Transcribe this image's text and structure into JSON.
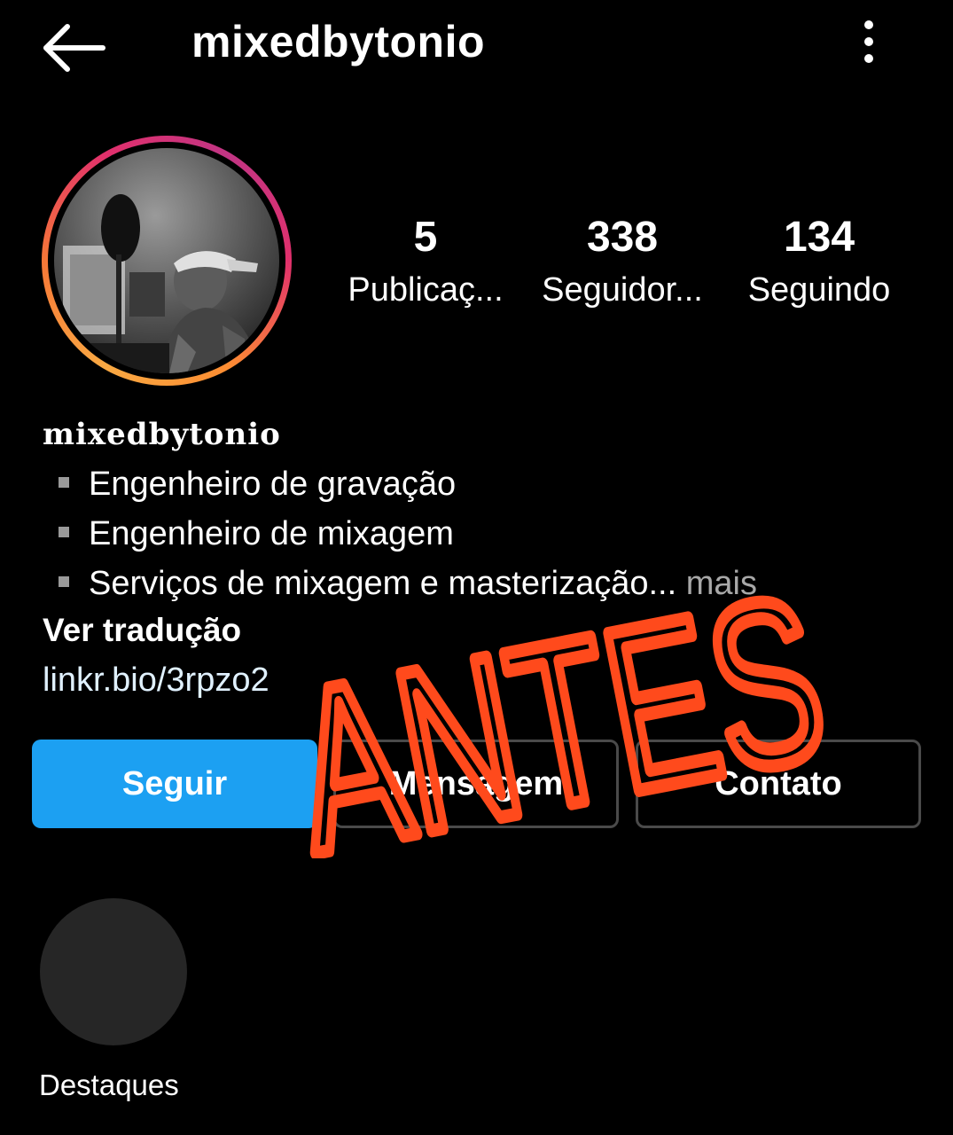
{
  "header": {
    "username": "mixedbytonio",
    "back_icon": "arrow-left-icon",
    "more_icon": "more-vertical-icon"
  },
  "stats": [
    {
      "value": "5",
      "label": "Publicaç..."
    },
    {
      "value": "338",
      "label": "Seguidor..."
    },
    {
      "value": "134",
      "label": "Seguindo"
    }
  ],
  "bio": {
    "display_name": "mixedbytonio",
    "lines": [
      "Engenheiro de gravação",
      "Engenheiro de mixagem",
      "Serviços de mixagem e masterização..."
    ],
    "more": " mais",
    "translate": "Ver tradução",
    "link": "linkr.bio/3rpzo2"
  },
  "actions": {
    "follow": "Seguir",
    "message": "Mensagem",
    "contact": "Contato"
  },
  "highlights": {
    "label": "Destaques"
  },
  "overlay": {
    "text": "ANTES",
    "color": "#ff4a1c"
  },
  "colors": {
    "background": "#000000",
    "follow_button": "#1ca0f2",
    "link": "#e0f1ff"
  }
}
